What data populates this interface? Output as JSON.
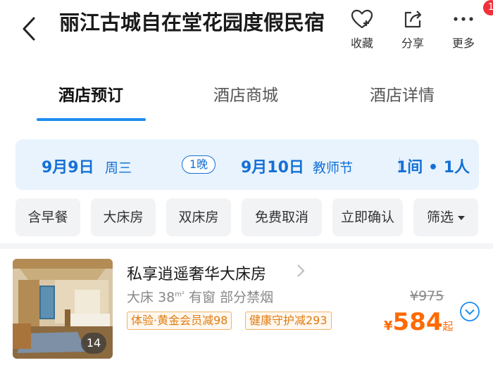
{
  "header": {
    "title": "丽江古城自在堂花园度假民宿",
    "actions": [
      {
        "label": "收藏",
        "icon": "heart-plus-icon"
      },
      {
        "label": "分享",
        "icon": "share-icon"
      },
      {
        "label": "更多",
        "icon": "more-dots-icon"
      }
    ],
    "badge_count": "1"
  },
  "tabs": [
    {
      "label": "酒店预订",
      "active": true
    },
    {
      "label": "酒店商城",
      "active": false
    },
    {
      "label": "酒店详情",
      "active": false
    }
  ],
  "date_bar": {
    "checkin_date": "9月9日",
    "checkin_day": "周三",
    "nights": "1晚",
    "checkout_date": "9月10日",
    "checkout_day": "教师节",
    "rooms_guests": "1间 • 1人"
  },
  "filters": [
    "含早餐",
    "大床房",
    "双床房",
    "免费取消",
    "立即确认",
    "筛选"
  ],
  "room": {
    "name": "私享逍遥奢华大床房",
    "bed": "大床",
    "area_num": "38",
    "area_unit": "m²",
    "window": "有窗",
    "smoking": "部分禁烟",
    "tags": [
      "体验·黄金会员减98",
      "健康守护减293"
    ],
    "original_price": "¥975",
    "currency": "¥",
    "price": "584",
    "price_suffix": "起",
    "photo_count": "14"
  },
  "colors": {
    "accent": "#1e8cf0",
    "price": "#ff6a00",
    "badge": "#f0313b",
    "date_bg": "#e8f3fd"
  }
}
